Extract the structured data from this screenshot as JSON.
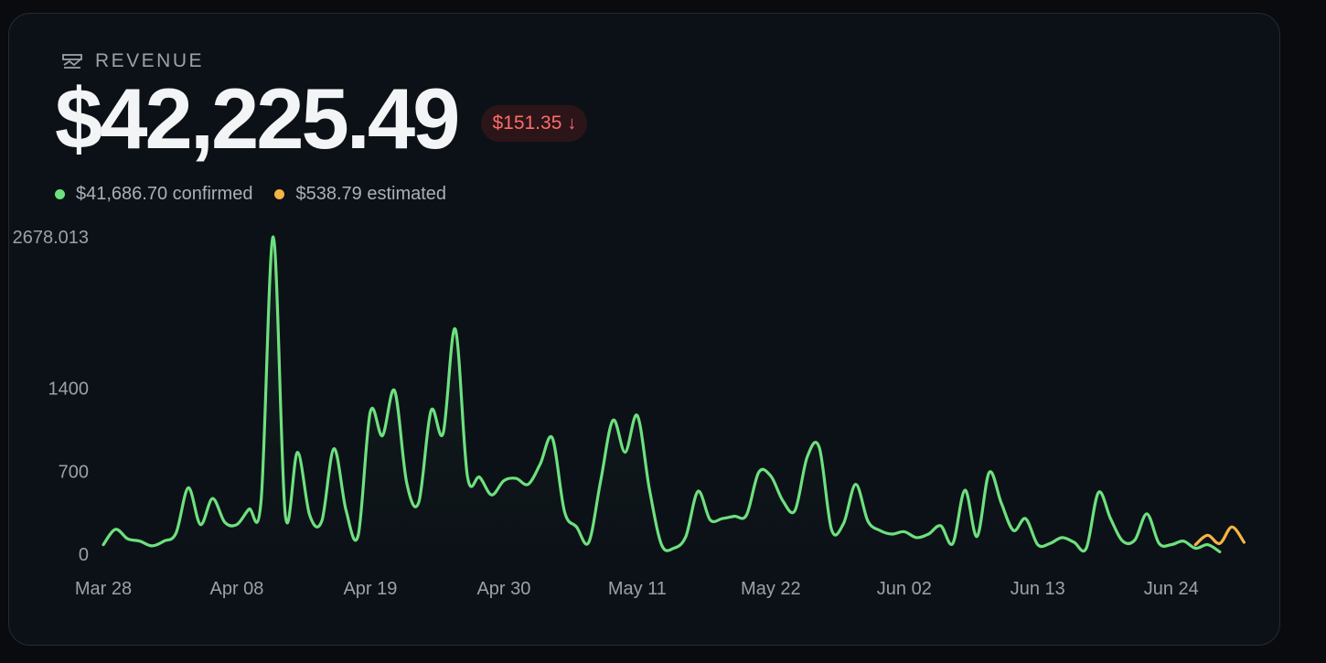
{
  "card": {
    "label": "REVENUE",
    "icon": "chart-icon",
    "total": "$42,225.49",
    "delta": {
      "value": "$151.35",
      "direction": "down",
      "arrow": "↓",
      "color": "#ff6b6b"
    },
    "confirmed": {
      "text": "$41,686.70 confirmed",
      "color": "#6ee07f"
    },
    "estimated": {
      "text": "$538.79 estimated",
      "color": "#f5b443"
    }
  },
  "chart_data": {
    "type": "line",
    "title": "",
    "xlabel": "",
    "ylabel": "",
    "ylim": [
      0,
      2678.013
    ],
    "y_ticks": [
      "0",
      "700",
      "1400",
      "2678.013"
    ],
    "x_ticks": [
      "Mar 28",
      "Apr 08",
      "Apr 19",
      "Apr 30",
      "May 11",
      "May 22",
      "Jun 02",
      "Jun 13",
      "Jun 24"
    ],
    "x_start": "Mar 28",
    "grid": false,
    "series": [
      {
        "status": "confirmed",
        "color": "#6ee07f",
        "points": [
          [
            "Mar 28",
            80
          ],
          [
            "Mar 29",
            210
          ],
          [
            "Mar 30",
            130
          ],
          [
            "Mar 31",
            110
          ],
          [
            "Apr 01",
            70
          ],
          [
            "Apr 02",
            110
          ],
          [
            "Apr 03",
            180
          ],
          [
            "Apr 04",
            560
          ],
          [
            "Apr 05",
            250
          ],
          [
            "Apr 06",
            470
          ],
          [
            "Apr 07",
            270
          ],
          [
            "Apr 08",
            250
          ],
          [
            "Apr 09",
            380
          ],
          [
            "Apr 10",
            450
          ],
          [
            "Apr 11",
            2678
          ],
          [
            "Apr 12",
            330
          ],
          [
            "Apr 13",
            860
          ],
          [
            "Apr 14",
            330
          ],
          [
            "Apr 15",
            280
          ],
          [
            "Apr 16",
            890
          ],
          [
            "Apr 17",
            370
          ],
          [
            "Apr 18",
            160
          ],
          [
            "Apr 19",
            1200
          ],
          [
            "Apr 20",
            1000
          ],
          [
            "Apr 21",
            1380
          ],
          [
            "Apr 22",
            600
          ],
          [
            "Apr 23",
            440
          ],
          [
            "Apr 24",
            1210
          ],
          [
            "Apr 25",
            1020
          ],
          [
            "Apr 26",
            1900
          ],
          [
            "Apr 27",
            660
          ],
          [
            "Apr 28",
            650
          ],
          [
            "Apr 29",
            500
          ],
          [
            "Apr 30",
            620
          ],
          [
            "May 01",
            640
          ],
          [
            "May 02",
            590
          ],
          [
            "May 03",
            760
          ],
          [
            "May 04",
            980
          ],
          [
            "May 05",
            360
          ],
          [
            "May 06",
            230
          ],
          [
            "May 07",
            100
          ],
          [
            "May 08",
            630
          ],
          [
            "May 09",
            1130
          ],
          [
            "May 10",
            860
          ],
          [
            "May 11",
            1170
          ],
          [
            "May 12",
            550
          ],
          [
            "May 13",
            80
          ],
          [
            "May 14",
            50
          ],
          [
            "May 15",
            150
          ],
          [
            "May 16",
            530
          ],
          [
            "May 17",
            290
          ],
          [
            "May 18",
            300
          ],
          [
            "May 19",
            320
          ],
          [
            "May 20",
            330
          ],
          [
            "May 21",
            690
          ],
          [
            "May 22",
            660
          ],
          [
            "May 23",
            450
          ],
          [
            "May 24",
            370
          ],
          [
            "May 25",
            820
          ],
          [
            "May 26",
            900
          ],
          [
            "May 27",
            210
          ],
          [
            "May 28",
            260
          ],
          [
            "May 29",
            590
          ],
          [
            "May 30",
            280
          ],
          [
            "May 31",
            200
          ],
          [
            "Jun 01",
            170
          ],
          [
            "Jun 02",
            190
          ],
          [
            "Jun 03",
            140
          ],
          [
            "Jun 04",
            170
          ],
          [
            "Jun 05",
            240
          ],
          [
            "Jun 06",
            90
          ],
          [
            "Jun 07",
            540
          ],
          [
            "Jun 08",
            150
          ],
          [
            "Jun 09",
            690
          ],
          [
            "Jun 10",
            430
          ],
          [
            "Jun 11",
            200
          ],
          [
            "Jun 12",
            300
          ],
          [
            "Jun 13",
            80
          ],
          [
            "Jun 14",
            90
          ],
          [
            "Jun 15",
            140
          ],
          [
            "Jun 16",
            100
          ],
          [
            "Jun 17",
            50
          ],
          [
            "Jun 18",
            520
          ],
          [
            "Jun 19",
            300
          ],
          [
            "Jun 20",
            110
          ],
          [
            "Jun 21",
            120
          ],
          [
            "Jun 22",
            340
          ],
          [
            "Jun 23",
            90
          ],
          [
            "Jun 24",
            80
          ],
          [
            "Jun 25",
            110
          ],
          [
            "Jun 26",
            50
          ],
          [
            "Jun 27",
            80
          ],
          [
            "Jun 28",
            20
          ]
        ]
      },
      {
        "status": "estimated",
        "color": "#f5b443",
        "points": [
          [
            "Jun 26",
            80
          ],
          [
            "Jun 27",
            160
          ],
          [
            "Jun 28",
            90
          ],
          [
            "Jun 29",
            230
          ],
          [
            "Jun 30",
            100
          ]
        ]
      }
    ]
  }
}
